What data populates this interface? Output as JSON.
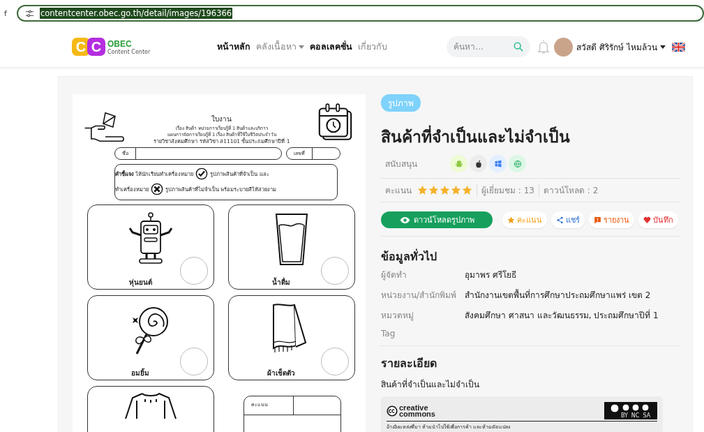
{
  "browser": {
    "edge_fragment": "f",
    "url": "contentcenter.obec.go.th/detail/images/196366"
  },
  "header": {
    "logo": {
      "letters": [
        "C",
        "C"
      ],
      "name": "OBEC",
      "subtitle": "Content Center"
    },
    "nav": [
      {
        "label": "หน้าหลัก",
        "emphasized": true,
        "dropdown": false
      },
      {
        "label": "คลังเนื้อหา",
        "emphasized": false,
        "dropdown": true
      },
      {
        "label": "คอลเลคชั่น",
        "emphasized": true,
        "dropdown": false
      },
      {
        "label": "เกี่ยวกับ",
        "emphasized": false,
        "dropdown": false
      }
    ],
    "search": {
      "placeholder": "ค้นหา..."
    },
    "user": {
      "name": "สวัสดี ศิริรักษ์ ไหมล้วน"
    }
  },
  "worksheet": {
    "title": "ใบงาน",
    "lines": [
      "เรื่อง สินค้า หน่วยการเรียนรู้ที่ 1 สินค้าและบริการ",
      "แผนการจัดการเรียนรู้ที่ 1 เรื่อง สินค้าที่ใช้ในชีวิตประจำวัน",
      "รายวิชาสังคมศึกษา รหัสวิชา ส11101 ชั้นประถมศึกษาปีที่ 1"
    ],
    "name_label": "ชื่อ",
    "number_label": "เลขที่",
    "instruction": {
      "lead": "คำชี้แจง",
      "line1": "ให้นักเรียนทำเครื่องหมาย",
      "line1_end": "รูปภาพสินค้าที่จำเป็น และ",
      "line2": "ทำเครื่องหมาย",
      "line2_end": "รูปภาพสินค้าที่ไม่จำเป็น พร้อมระบายสีให้สวยงาม"
    },
    "cards": [
      {
        "kind": "robot",
        "label": "หุ่นยนต์"
      },
      {
        "kind": "glass",
        "label": "น้ำดื่ม"
      },
      {
        "kind": "lollipop",
        "label": "อมยิ้ม"
      },
      {
        "kind": "towel",
        "label": "ผ้าเช็ดตัว"
      },
      {
        "kind": "shirt"
      }
    ],
    "score_label": "คะแนน"
  },
  "detail": {
    "type_tag": "รูปภาพ",
    "title": "สินค้าที่จำเป็นและไม่จำเป็น",
    "support_label": "สนับสนุน",
    "platforms": [
      {
        "kind": "android"
      },
      {
        "kind": "apple"
      },
      {
        "kind": "windows"
      },
      {
        "kind": "web"
      }
    ],
    "rating": {
      "label": "คะแนน",
      "stars": 5
    },
    "views": "ผู้เยี่ยมชม : 13",
    "downloads": "ดาวน์โหลด : 2",
    "download_button": "ดาวน์โหลดรูปภาพ",
    "actions": [
      {
        "kind": "rate",
        "label": "คะแนน"
      },
      {
        "kind": "share",
        "label": "แชร์"
      },
      {
        "kind": "report",
        "label": "รายงาน"
      },
      {
        "kind": "save",
        "label": "บันทึก"
      }
    ],
    "info_heading": "ข้อมูลทั่วไป",
    "info": [
      {
        "label": "ผู้จัดทำ",
        "value": "อุมาพร ศรีโยธี"
      },
      {
        "label": "หน่วยงาน/สำนักพิมพ์",
        "value": "สำนักงานเขตพื้นที่การศึกษาประถมศึกษาแพร่ เขต 2"
      },
      {
        "label": "หมวดหมู่",
        "value": "สังคมศึกษา ศาสนา และวัฒนธรรม, ประถมศึกษาปีที่ 1"
      },
      {
        "label": "Tag"
      }
    ],
    "details_heading": "รายละเอียด",
    "details_text": "สินค้าที่จำเป็นและไม่จำเป็น",
    "license": {
      "logo_top": "creative",
      "logo_bottom": "commons",
      "badge_parts": [
        "BY",
        "NC",
        "SA"
      ],
      "text": "อ้างอิงแหล่งที่มา ห้ามนำไปใช้เพื่อการค้า และห้ามดัดแปลง"
    }
  }
}
